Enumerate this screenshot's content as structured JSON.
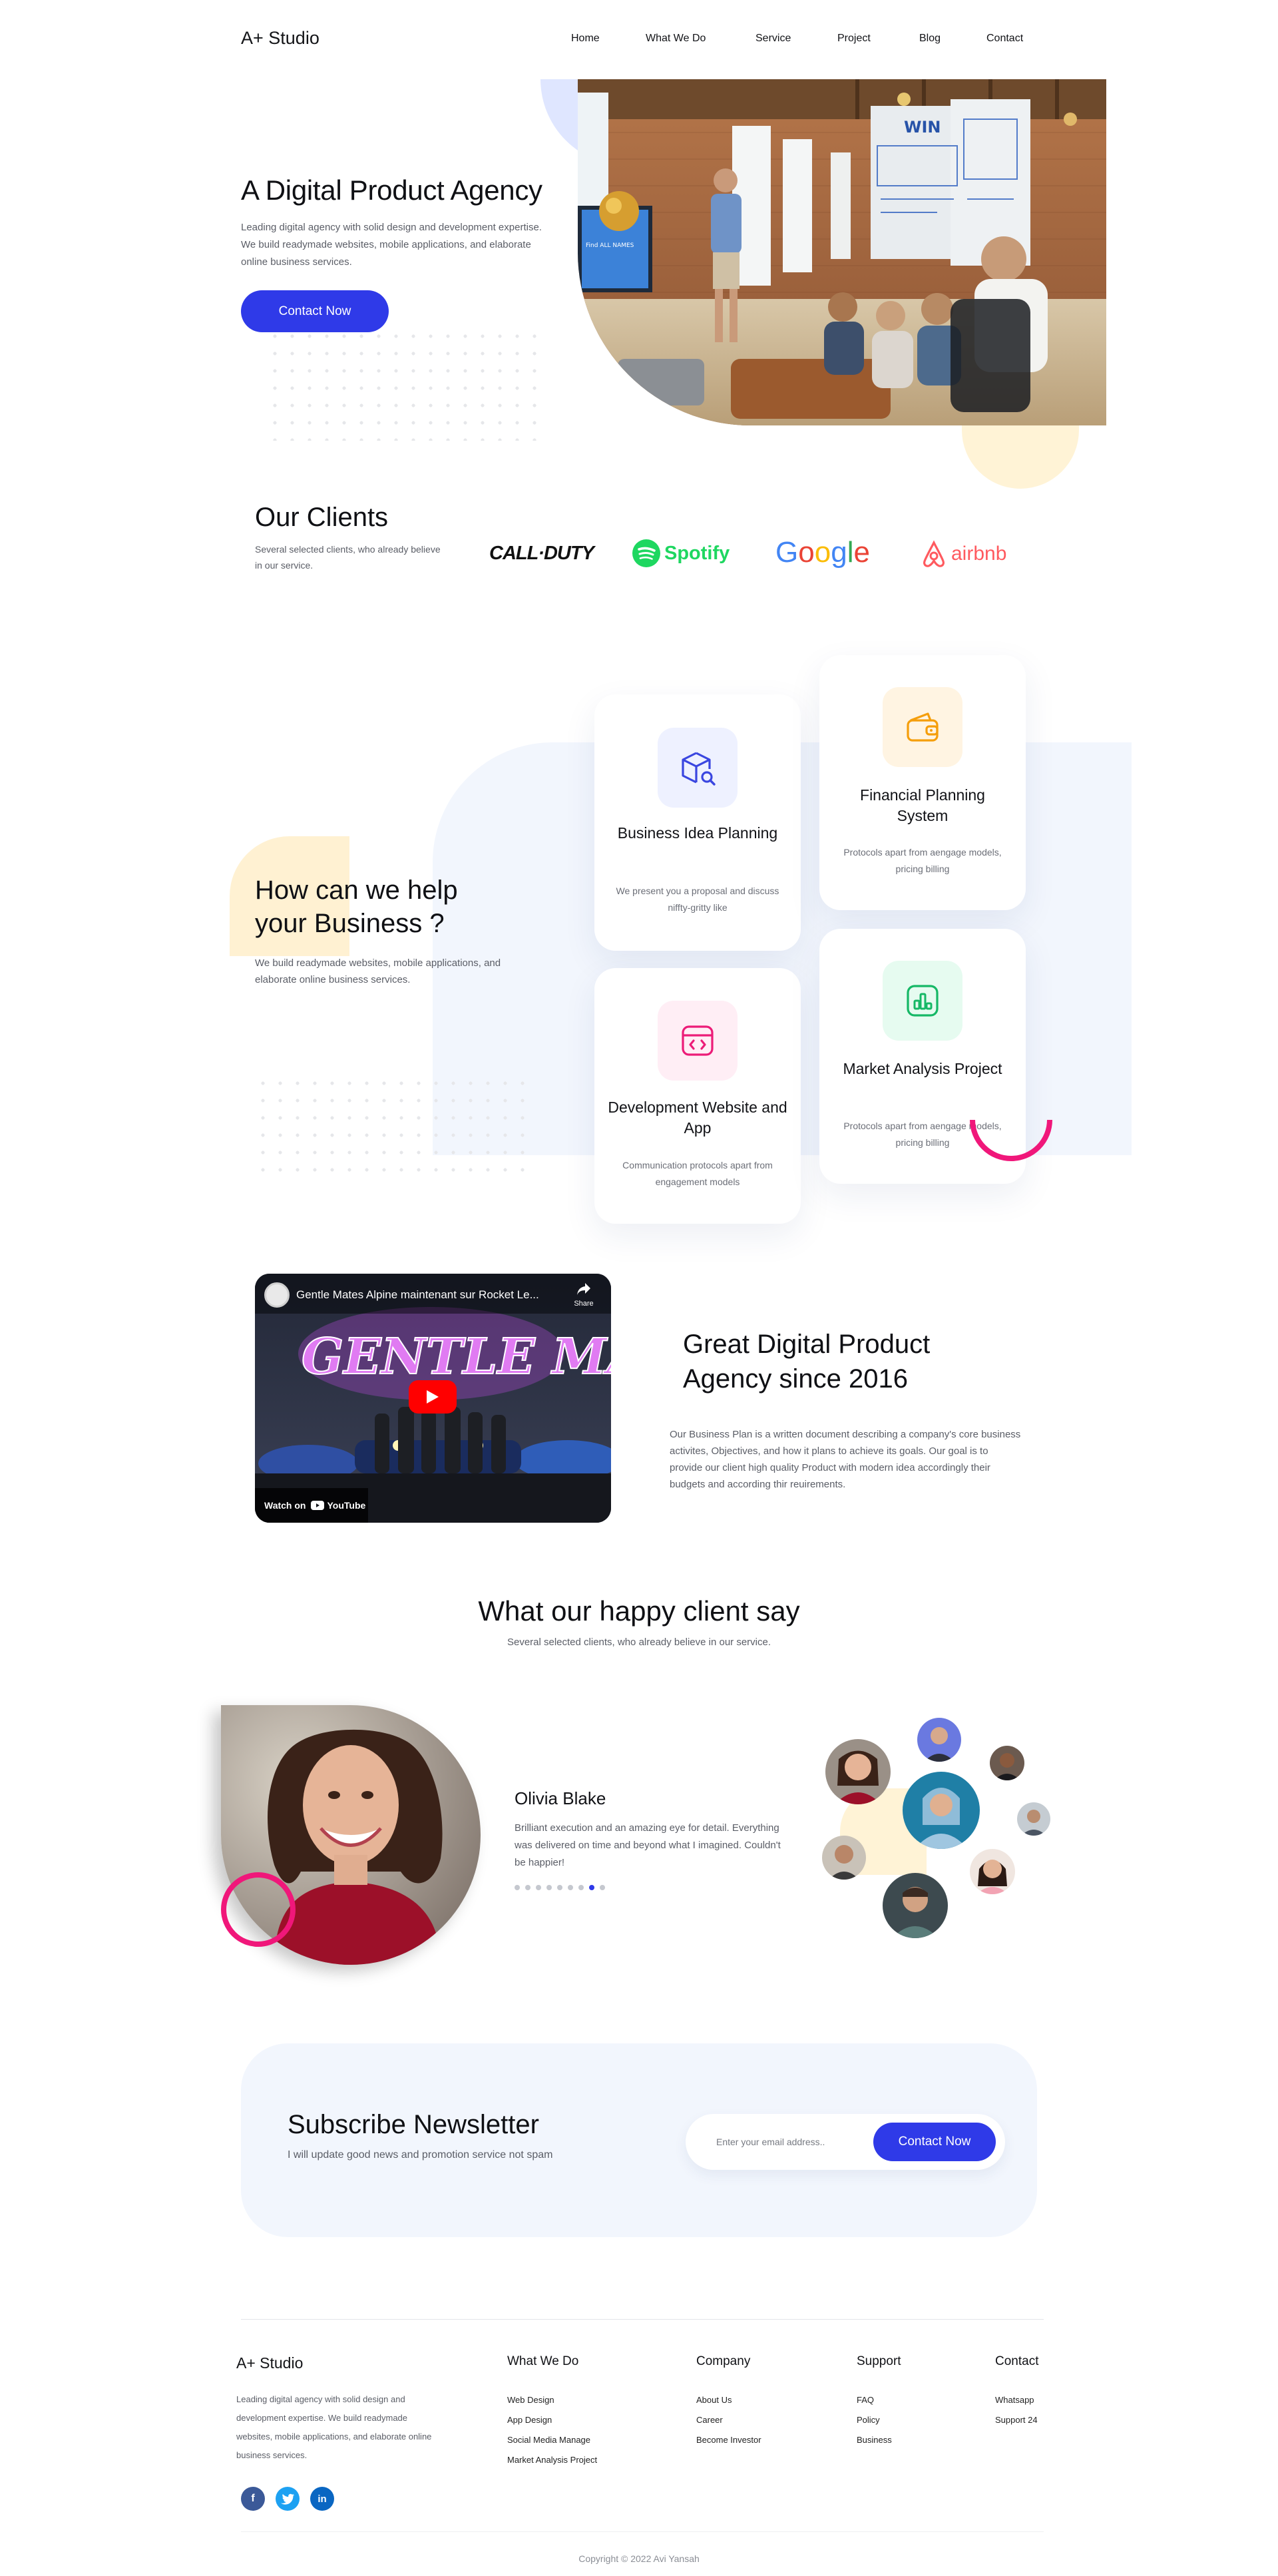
{
  "brand": "A+ Studio",
  "nav": [
    "Home",
    "What We Do",
    "Service",
    "Project",
    "Blog",
    "Contact"
  ],
  "hero": {
    "title": "A Digital Product Agency",
    "description": "Leading digital agency with solid design and development expertise. We build readymade websites, mobile applications, and elaborate online business services.",
    "cta": "Contact Now",
    "photo": {
      "screen_text": "Find ALL NAMES",
      "wall_sign": "WIN"
    }
  },
  "clients": {
    "title": "Our Clients",
    "description": "Several selected clients, who already believe in our service.",
    "logos": [
      "CALL·DUTY",
      "Spotify",
      "Google",
      "airbnb"
    ]
  },
  "services": {
    "title": "How can we help your Business ?",
    "description": "We build readymade websites, mobile applications, and elaborate online business services.",
    "cards": [
      {
        "title": "Business Idea Planning",
        "description": "We present you a proposal and discuss niffty-gritty like",
        "icon": "package-search-icon",
        "color": "#3a46e0",
        "bg": "#eef1ff"
      },
      {
        "title": "Financial Planning System",
        "description": "Protocols apart from aengage models, pricing billing",
        "icon": "wallet-icon",
        "color": "#f59e0b",
        "bg": "#fff4e2"
      },
      {
        "title": "Development Website and App",
        "description": "Communication protocols apart from engagement models",
        "icon": "code-window-icon",
        "color": "#ec1c78",
        "bg": "#ffeef5"
      },
      {
        "title": "Market Analysis Project",
        "description": "Protocols apart from aengage models, pricing billing",
        "icon": "chart-icon",
        "color": "#16b866",
        "bg": "#e6fbf0"
      }
    ]
  },
  "video": {
    "title": "Gentle Mates Alpine maintenant sur Rocket Le...",
    "share": "Share",
    "watch_on": "Watch on",
    "platform": "YouTube",
    "art_text": "GENTLE MATES"
  },
  "about": {
    "title": "Great Digital Product Agency since 2016",
    "description": "Our Business Plan is a written document describing a company's core business activites, Objectives, and how it plans to achieve its goals. Our goal is to provide our client high quality Product with modern idea accordingly their budgets and according thir reuirements."
  },
  "testimonials": {
    "title": "What our happy client say",
    "subtitle": "Several selected clients, who already believe in our service.",
    "name": "Olivia Blake",
    "quote": "Brilliant execution and an amazing eye for detail. Everything was delivered on time and beyond what I imagined. Couldn't be happier!",
    "dots": 9,
    "active_dot": 7
  },
  "newsletter": {
    "title": "Subscribe Newsletter",
    "subtitle": "I will update good news and promotion service not spam",
    "placeholder": "Enter your email address..",
    "cta": "Contact Now"
  },
  "footer": {
    "brand": "A+ Studio",
    "description": "Leading digital agency with solid design and development expertise. We build readymade websites, mobile applications, and elaborate online business services.",
    "columns": [
      {
        "title": "What We Do",
        "links": [
          "Web Design",
          "App Design",
          "Social Media Manage",
          "Market Analysis Project"
        ]
      },
      {
        "title": "Company",
        "links": [
          "About Us",
          "Career",
          "Become Investor"
        ]
      },
      {
        "title": "Support",
        "links": [
          "FAQ",
          "Policy",
          "Business"
        ]
      },
      {
        "title": "Contact",
        "links": [
          "Whatsapp",
          "Support 24"
        ]
      }
    ],
    "social": [
      {
        "name": "facebook-icon",
        "letter": "f",
        "color": "#3b5998"
      },
      {
        "name": "twitter-icon",
        "letter": "t",
        "color": "#1da1f2"
      },
      {
        "name": "linkedin-icon",
        "letter": "in",
        "color": "#0a66c2"
      }
    ],
    "copyright": "Copyright © 2022 Avi Yansah"
  },
  "colors": {
    "primary": "#2f3ae8",
    "accent_pink": "#f0177a",
    "cream": "#fff3d6",
    "light_blue": "#f2f6fd"
  }
}
